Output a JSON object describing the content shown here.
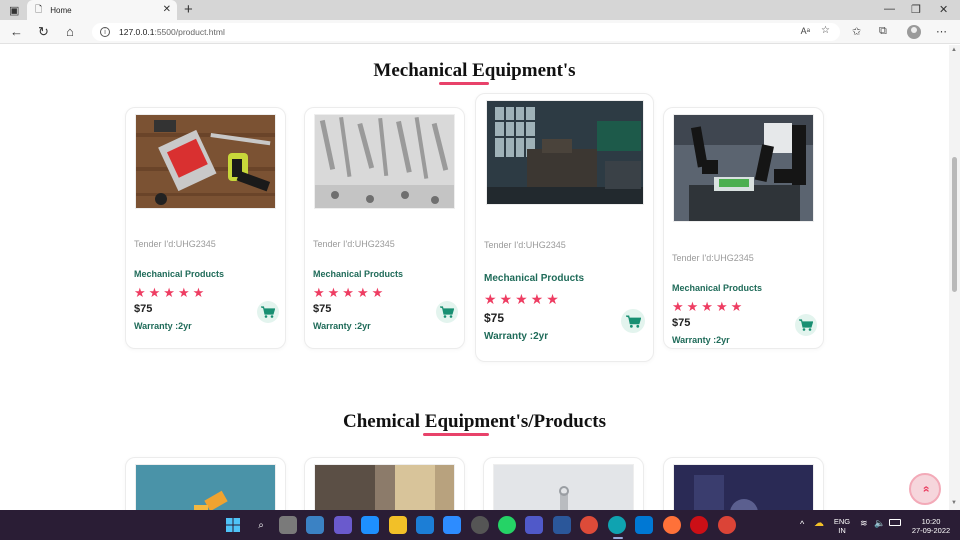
{
  "browser": {
    "tab_title": "Home",
    "url_host": "127.0.0.1",
    "url_path": ":5500/product.html"
  },
  "sections": [
    {
      "title": "Mechanical Equipment's",
      "cards": [
        {
          "tender": "Tender I'd:UHG2345",
          "category": "Mechanical Products",
          "rating": 5,
          "price": "$75",
          "warranty": "Warranty :2yr",
          "image": "tools-photo"
        },
        {
          "tender": "Tender I'd:UHG2345",
          "category": "Mechanical Products",
          "rating": 5,
          "price": "$75",
          "warranty": "Warranty :2yr",
          "image": "bolts-photo"
        },
        {
          "tender": "Tender I'd:UHG2345",
          "category": "Mechanical Products",
          "rating": 5,
          "price": "$75",
          "warranty": "Warranty :2yr",
          "image": "factory-machine-photo"
        },
        {
          "tender": "Tender I'd:UHG2345",
          "category": "Mechanical Products",
          "rating": 5,
          "price": "$75",
          "warranty": "Warranty :2yr",
          "image": "robot-arms-photo"
        }
      ]
    },
    {
      "title": "Chemical Equipment's/Products"
    }
  ],
  "stars": "★★★★★",
  "taskbar": {
    "lang_line1": "ENG",
    "lang_line2": "IN",
    "time": "10:20",
    "date": "27-09-2022"
  },
  "colors": {
    "accent": "#ee3d62",
    "product_text": "#1f6b59",
    "cart_bg": "#e3f4ee"
  }
}
